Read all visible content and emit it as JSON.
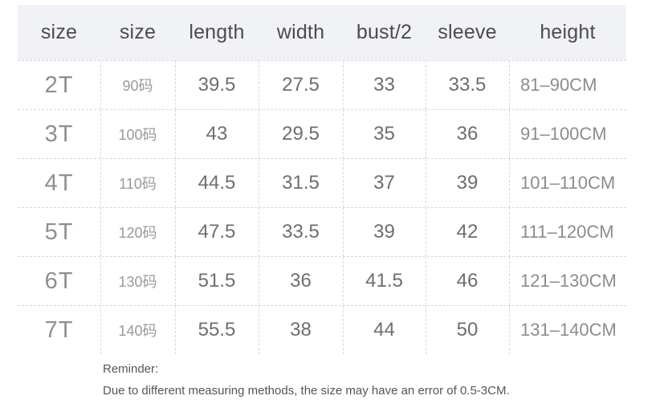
{
  "table": {
    "columns": [
      {
        "key": "size_t",
        "label": "size"
      },
      {
        "key": "size_cn",
        "label": "size"
      },
      {
        "key": "length",
        "label": "length"
      },
      {
        "key": "width",
        "label": "width"
      },
      {
        "key": "bust",
        "label": "bust/2"
      },
      {
        "key": "sleeve",
        "label": "sleeve"
      },
      {
        "key": "height",
        "label": "height"
      }
    ],
    "rows": [
      {
        "size_t": "2T",
        "size_cn": "90码",
        "length": "39.5",
        "width": "27.5",
        "bust": "33",
        "sleeve": "33.5",
        "height": "81–90CM"
      },
      {
        "size_t": "3T",
        "size_cn": "100码",
        "length": "43",
        "width": "29.5",
        "bust": "35",
        "sleeve": "36",
        "height": "91–100CM"
      },
      {
        "size_t": "4T",
        "size_cn": "110码",
        "length": "44.5",
        "width": "31.5",
        "bust": "37",
        "sleeve": "39",
        "height": "101–110CM"
      },
      {
        "size_t": "5T",
        "size_cn": "120码",
        "length": "47.5",
        "width": "33.5",
        "bust": "39",
        "sleeve": "42",
        "height": "111–120CM"
      },
      {
        "size_t": "6T",
        "size_cn": "130码",
        "length": "51.5",
        "width": "36",
        "bust": "41.5",
        "sleeve": "46",
        "height": "121–130CM"
      },
      {
        "size_t": "7T",
        "size_cn": "140码",
        "length": "55.5",
        "width": "38",
        "bust": "44",
        "sleeve": "50",
        "height": "131–140CM"
      }
    ]
  },
  "footer": {
    "title": "Reminder:",
    "note": "Due to different measuring methods, the size may have an error of 0.5-3CM."
  },
  "colors": {
    "header_band": "#f1f2f5",
    "grid_line": "#d8d8d8",
    "page_background": "#ffffff",
    "size_text": "#8f8f8f",
    "value_text": "#6e6e6e",
    "footer_text": "#555555"
  }
}
